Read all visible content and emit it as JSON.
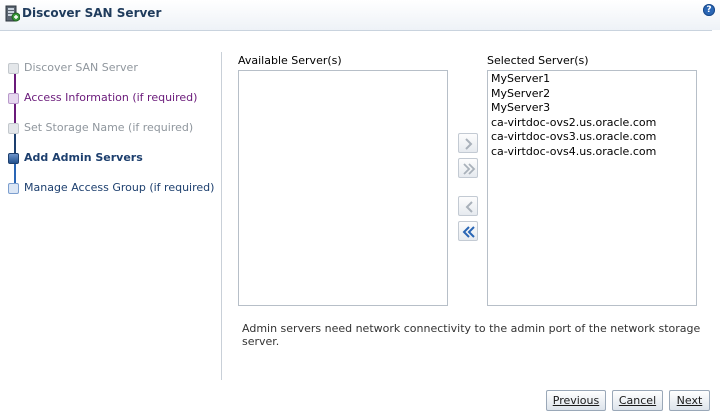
{
  "window": {
    "title": "Discover SAN Server",
    "help_glyph": "?"
  },
  "train": {
    "steps": [
      {
        "label": "Discover SAN Server",
        "state": "completed",
        "color": "#8f969d"
      },
      {
        "label": "Access Information (if required)",
        "state": "visited",
        "color": "#6a1a7a"
      },
      {
        "label": "Set Storage Name (if required)",
        "state": "completed",
        "color": "#8f969d"
      },
      {
        "label": "Add Admin Servers",
        "state": "current",
        "color": "#1d3f6e"
      },
      {
        "label": "Manage Access Group (if required)",
        "state": "unvisited",
        "color": "#1d3f6e"
      }
    ]
  },
  "shuttle": {
    "available_label": "Available Server(s)",
    "available_items": [],
    "selected_label": "Selected Server(s)",
    "selected_items": [
      "MyServer1",
      "MyServer2",
      "MyServer3",
      "ca-virtdoc-ovs2.us.oracle.com",
      "ca-virtdoc-ovs3.us.oracle.com",
      "ca-virtdoc-ovs4.us.oracle.com"
    ],
    "buttons": {
      "move": "chevron-right-icon",
      "move_all": "double-chevron-right-icon",
      "remove": "chevron-left-icon",
      "remove_all": "double-chevron-left-icon"
    }
  },
  "help_text": "Admin servers need network connectivity to the admin port of the network storage server.",
  "footer": {
    "previous_label": "Previous",
    "cancel_label": "Cancel",
    "next_label": "Next"
  },
  "colors": {
    "accent": "#2a66b5",
    "title": "#1f3b5c",
    "border": "#b7bfc8"
  }
}
